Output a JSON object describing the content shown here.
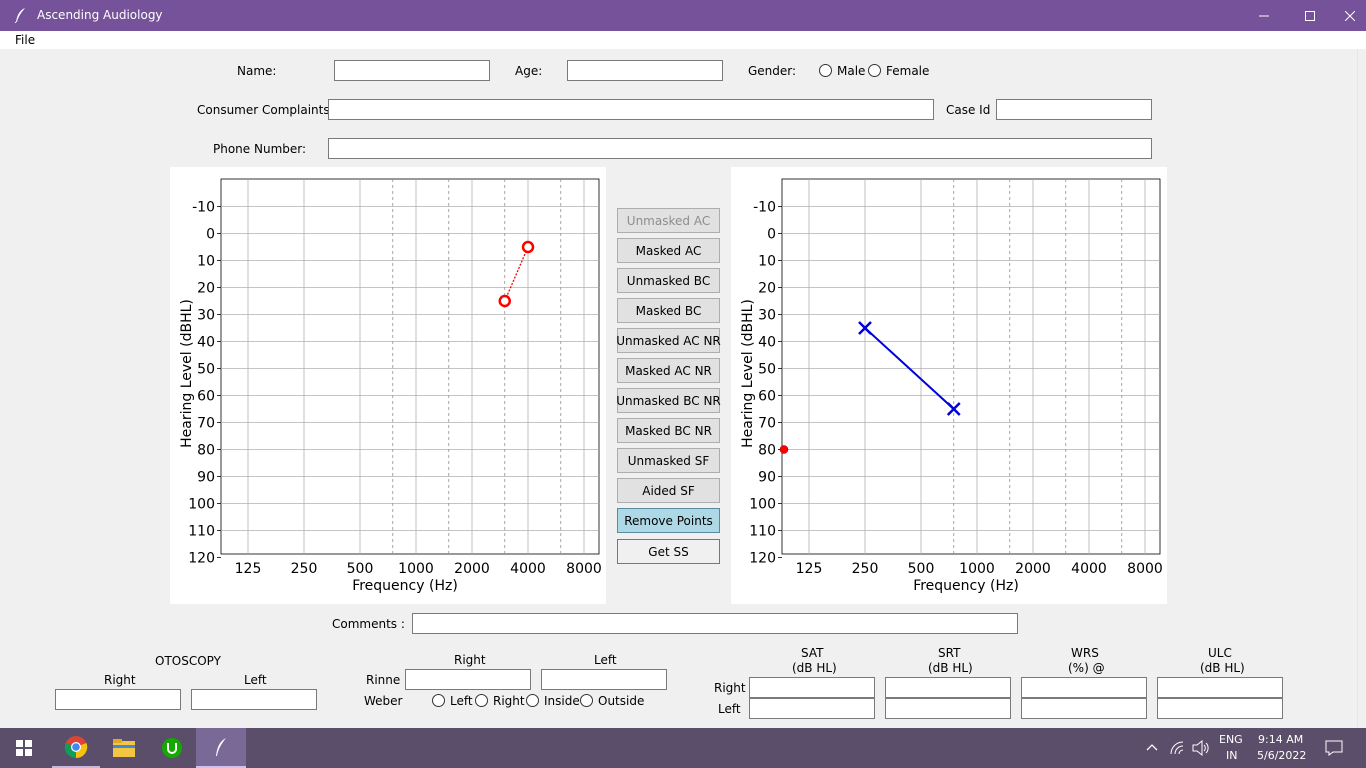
{
  "window": {
    "title": "Ascending Audiology"
  },
  "menu": {
    "file": "File"
  },
  "form": {
    "name_label": "Name:",
    "name_value": "",
    "age_label": "Age:",
    "age_value": "",
    "gender_label": "Gender:",
    "gender_male": "Male",
    "gender_female": "Female",
    "complaints_label": "Consumer Complaints",
    "complaints_value": "",
    "caseid_label": "Case Id",
    "caseid_value": "",
    "phone_label": "Phone Number:",
    "phone_value": ""
  },
  "buttons": [
    "Unmasked AC",
    "Masked AC",
    "Unmasked BC",
    "Masked BC",
    "Unmasked AC NR",
    "Masked AC NR",
    "Unmasked BC NR",
    "Masked BC NR",
    "Unmasked SF",
    "Aided SF",
    "Remove Points",
    "Get SS"
  ],
  "chart_data": [
    {
      "type": "line",
      "ylabel": "Hearing Level (dBHL)",
      "xlabel": "Frequency (Hz)",
      "y_ticks": [
        "-10",
        "0",
        "10",
        "20",
        "30",
        "40",
        "50",
        "60",
        "70",
        "80",
        "90",
        "100",
        "110",
        "120"
      ],
      "x_ticks": [
        "125",
        "250",
        "500",
        "1000",
        "2000",
        "4000",
        "8000"
      ],
      "ylim": [
        -10,
        120
      ],
      "y_inverted": true,
      "grid": true,
      "series": [
        {
          "marker": "circle",
          "color": "#ff0000",
          "linestyle": "dotted",
          "points": [
            {
              "x": 3000,
              "y": 25
            },
            {
              "x": 4000,
              "y": 5
            }
          ]
        }
      ],
      "extra_points": []
    },
    {
      "type": "line",
      "ylabel": "Hearing Level (dBHL)",
      "xlabel": "Frequency (Hz)",
      "y_ticks": [
        "-10",
        "0",
        "10",
        "20",
        "30",
        "40",
        "50",
        "60",
        "70",
        "80",
        "90",
        "100",
        "110",
        "120"
      ],
      "x_ticks": [
        "125",
        "250",
        "500",
        "1000",
        "2000",
        "4000",
        "8000"
      ],
      "ylim": [
        -10,
        120
      ],
      "y_inverted": true,
      "grid": true,
      "series": [
        {
          "marker": "x",
          "color": "#0000dd",
          "linestyle": "solid",
          "points": [
            {
              "x": 250,
              "y": 35
            },
            {
              "x": 750,
              "y": 65
            }
          ]
        }
      ],
      "extra_points": [
        {
          "x": 62.5,
          "y": 80,
          "marker": "dot",
          "color": "#ff0000"
        }
      ]
    }
  ],
  "comments": {
    "label": "Comments :",
    "value": ""
  },
  "otoscopy": {
    "title": "OTOSCOPY",
    "right": "Right",
    "left": "Left"
  },
  "rinne_weber": {
    "right": "Right",
    "left": "Left",
    "rinne": "Rinne",
    "weber": "Weber",
    "opt_left": "Left",
    "opt_right": "Right",
    "opt_inside": "Inside",
    "opt_outside": "Outside"
  },
  "tests": {
    "sat": "SAT",
    "sat_unit": "(dB HL)",
    "srt": "SRT",
    "srt_unit": "(dB HL)",
    "wrs": "WRS",
    "wrs_unit": "(%) @",
    "ulc": "ULC",
    "ulc_unit": "(dB HL)",
    "row_right": "Right",
    "row_left": "Left"
  },
  "taskbar": {
    "lang": "ENG",
    "region": "IN",
    "time": "9:14 AM",
    "date": "5/6/2022"
  },
  "icons": [
    "feather-icon",
    "minimize-icon",
    "maximize-icon",
    "close-icon",
    "windows-start-icon",
    "chrome-icon",
    "file-explorer-icon",
    "upwork-icon",
    "feather-app-icon",
    "chevron-up-icon",
    "wifi-icon",
    "volume-icon",
    "notification-icon"
  ]
}
